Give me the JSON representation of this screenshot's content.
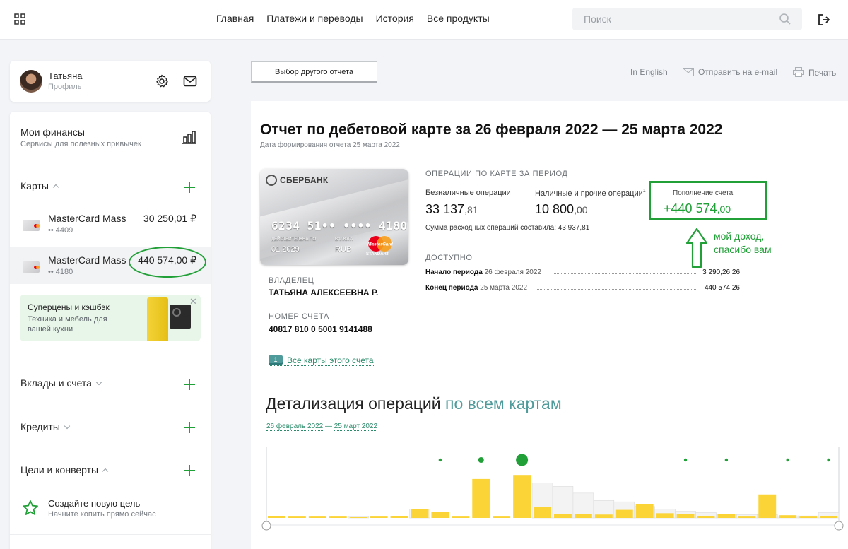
{
  "nav": {
    "items": [
      "Главная",
      "Платежи и переводы",
      "История",
      "Все продукты"
    ],
    "search_placeholder": "Поиск"
  },
  "profile": {
    "name": "Татьяна",
    "sub": "Профиль"
  },
  "sidebar": {
    "finances_title": "Мои финансы",
    "finances_sub": "Сервисы для полезных привычек",
    "cards_title": "Карты",
    "cards": [
      {
        "name": "MasterCard Mass",
        "number": "•• 4409",
        "amount": "30 250,01 ₽"
      },
      {
        "name": "MasterCard Mass",
        "number": "•• 4180",
        "amount": "440 574,00 ₽"
      }
    ],
    "promo": {
      "title": "Суперцены и кэшбэк",
      "sub": "Техника и мебель для вашей кухни",
      "close": "✕"
    },
    "deposits_title": "Вклады и счета",
    "credits_title": "Кредиты",
    "goals_title": "Цели и конверты",
    "goal_new_title": "Создайте новую цель",
    "goal_new_sub": "Начните копить прямо сейчас"
  },
  "toolbar": {
    "report_button": "Выбор другого отчета",
    "english": "In English",
    "email": "Отправить на e-mail",
    "print": "Печать"
  },
  "report": {
    "title": "Отчет по дебетовой карте за 26 февраля 2022 — 25 марта 2022",
    "date": "Дата формирования отчета 25 марта 2022",
    "card": {
      "bank": "СБЕРБАНК",
      "number": "6234 51•• •••• 4180",
      "valid_label": "ДЕЙСТВИТЕЛЬНА ПО",
      "valid": "01.2029",
      "currency_label": "ВАЛЮТА",
      "currency": "RUB",
      "brand": "MasterCard",
      "tier": "STANDART"
    },
    "owner_label": "ВЛАДЕЛЕЦ",
    "owner": "ТАТЬЯНА АЛЕКСЕЕВНА Р.",
    "account_label": "НОМЕР СЧЕТА",
    "account": "40817 810 0 5001 9141488",
    "all_cards_badge": "1",
    "all_cards_link": "Все карты этого счета",
    "ops_title": "ОПЕРАЦИИ ПО КАРТЕ ЗА ПЕРИОД",
    "cashless_label": "Безналичные операции",
    "cashless_int": "33 137",
    "cashless_frac": ",81",
    "cash_label": "Наличные и прочие операции",
    "cash_sup": "1",
    "cash_int": "10 800",
    "cash_frac": ",00",
    "income_label": "Пополнение счета",
    "income_int": "+440 574",
    "income_frac": ",00",
    "spend_sum": "Сумма расходных операций составила: 43 937,81",
    "annotation": "мой доход, спасибо вам",
    "avail_title": "ДОСТУПНО",
    "avail_start_label": "Начало периода",
    "avail_start_date": "26 февраля 2022",
    "avail_start_amount": "3 290,26,26",
    "avail_end_label": "Конец периода",
    "avail_end_date": "25 марта 2022",
    "avail_end_amount": "440 574,26"
  },
  "detail": {
    "title": "Детализация операций",
    "link": "по всем картам",
    "range_start": "26 февраль 2022",
    "range_sep": "—",
    "range_end": "25 март 2022"
  },
  "colors": {
    "accent": "#21a038",
    "bar_yellow": "#fbd438",
    "bar_gray": "#f1f1f1",
    "link_teal": "#4f9a9a"
  },
  "chart_data": {
    "type": "bar",
    "description_series": [
      {
        "name": "",
        "values": [
          0.03,
          0.02,
          0.02,
          0.02,
          0.01,
          0.02,
          0.03,
          0.13,
          0.09,
          0.02,
          0.58,
          0.02,
          0.64,
          0.16,
          0.06,
          0.06,
          0.05,
          0.12,
          0.2,
          0.07,
          0.06,
          0.03,
          0.06,
          0.02,
          0.35,
          0.04,
          0.02,
          0.03
        ]
      },
      {
        "name": "",
        "values": [
          0.0,
          0.0,
          0.0,
          0.0,
          0.02,
          0.0,
          0.0,
          0.13,
          0.0,
          0.0,
          0.0,
          0.0,
          0.0,
          0.52,
          0.47,
          0.37,
          0.26,
          0.24,
          0.17,
          0.13,
          0.1,
          0.08,
          0.06,
          0.05,
          0.05,
          0.03,
          0.03,
          0.08
        ]
      }
    ],
    "dots": [
      0,
      0,
      0,
      0,
      0,
      0,
      0,
      0,
      1,
      0,
      1,
      0,
      2,
      0,
      0,
      0,
      0,
      0,
      0,
      0,
      1,
      0,
      1,
      0,
      0,
      1,
      0,
      1
    ],
    "xlabel": "",
    "ylabel": ""
  }
}
